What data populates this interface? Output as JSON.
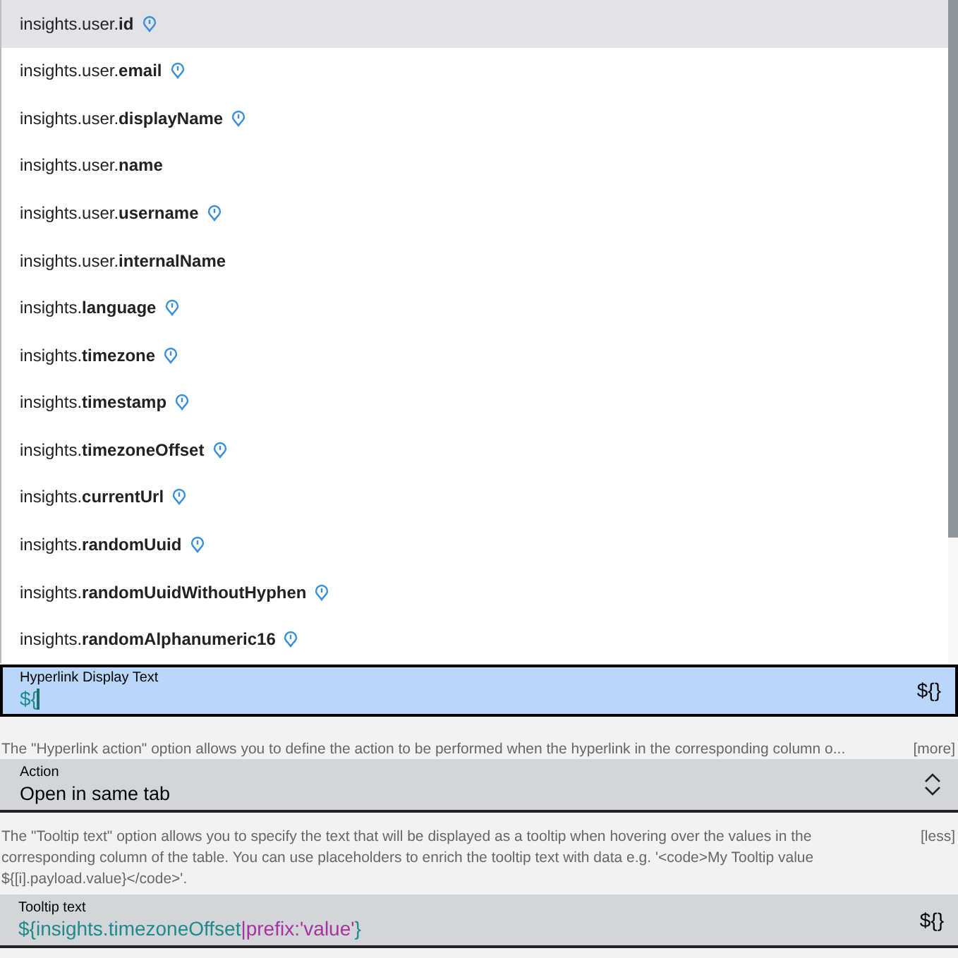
{
  "suggestions": [
    {
      "text": "insights.user.**id**",
      "info": true,
      "selected": true
    },
    {
      "text": "insights.user.**email**",
      "info": true,
      "selected": false
    },
    {
      "text": "insights.user.**displayName**",
      "info": true,
      "selected": false
    },
    {
      "text": "insights.user.**name**",
      "info": false,
      "selected": false
    },
    {
      "text": "insights.user.**username**",
      "info": true,
      "selected": false
    },
    {
      "text": "insights.user.**internalName**",
      "info": false,
      "selected": false
    },
    {
      "text": "insights.**language**",
      "info": true,
      "selected": false
    },
    {
      "text": "insights.**timezone**",
      "info": true,
      "selected": false
    },
    {
      "text": "insights.**timestamp**",
      "info": true,
      "selected": false
    },
    {
      "text": "insights.**timezoneOffset**",
      "info": true,
      "selected": false
    },
    {
      "text": "insights.**currentUrl**",
      "info": true,
      "selected": false
    },
    {
      "text": "insights.**randomUuid**",
      "info": true,
      "selected": false
    },
    {
      "text": "insights.**randomUuidWithoutHyphen**",
      "info": true,
      "selected": false
    },
    {
      "text": "insights.**randomAlphanumeric16**",
      "info": true,
      "selected": false
    }
  ],
  "hyperlink_field": {
    "label": "Hyperlink Display Text",
    "focused": true,
    "segments": [
      {
        "kind": "variable",
        "text": "${"
      }
    ],
    "button": "${}"
  },
  "hyperlink_action_help": {
    "text": "The \"Hyperlink action\" option allows you to define the action to be performed when the hyperlink in the corresponding column o...",
    "toggle": "[more]"
  },
  "action_select": {
    "label": "Action",
    "value": "Open in same tab"
  },
  "tooltip_help": {
    "text": "The \"Tooltip text\" option allows you to specify the text that will be displayed as a tooltip when hovering over the values in the corresponding column of the table. You can use placeholders to enrich the tooltip text with data e.g. '<code>My Tooltip value ${[i].payload.value}</code>'.",
    "toggle": "[less]"
  },
  "tooltip_field": {
    "label": "Tooltip text",
    "focused": false,
    "segments": [
      {
        "kind": "variable",
        "text": "${insights.timezoneOffset"
      },
      {
        "kind": "filter",
        "text": "|prefix:'value'"
      },
      {
        "kind": "variable",
        "text": "}"
      }
    ],
    "button": "${}"
  }
}
